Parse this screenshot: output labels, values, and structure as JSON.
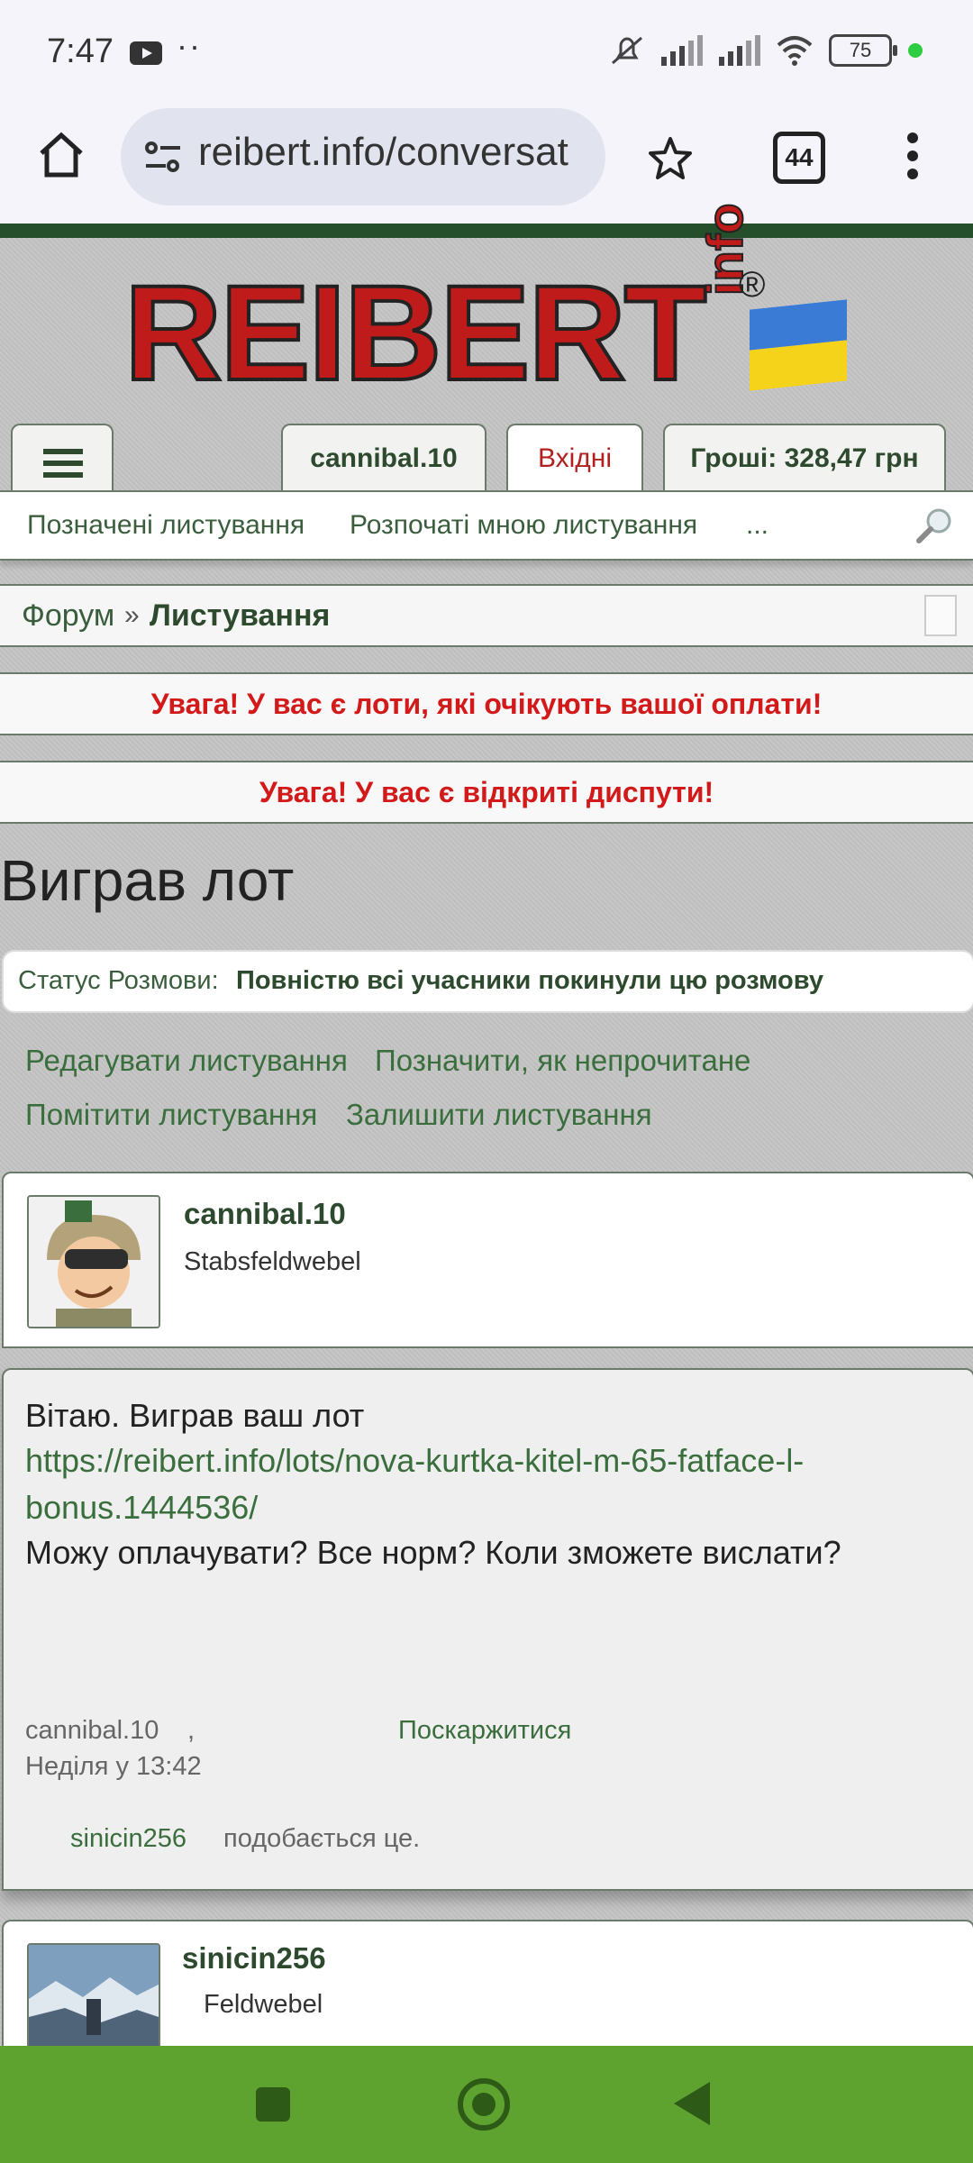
{
  "status_bar": {
    "time": "7:47",
    "dots": "··",
    "battery": "75"
  },
  "browser": {
    "url": "reibert.info/conversat",
    "tab_count": "44"
  },
  "site": {
    "logo_text": "REIBERT",
    "logo_info": "info",
    "logo_reg": "®",
    "tabs": {
      "user": "cannibal.10",
      "inbox": "Вхідні",
      "money": "Гроші: 328,47 грн"
    },
    "subnav": [
      "Позначені листування",
      "Розпочаті мною листування",
      "..."
    ],
    "breadcrumb": {
      "forum": "Форум",
      "sep": "»",
      "current": "Листування"
    },
    "alerts": [
      "Увага! У вас є лоти, які очікують вашої оплати!",
      "Увага! У вас є відкриті диспути!"
    ],
    "page_title": "Виграв лот",
    "status": {
      "label": "Статус Розмови:",
      "value": "Повністю всі учасники покинули цю розмову"
    },
    "actions": [
      "Редагувати листування",
      "Позначити, як непрочитане",
      "Помітити листування",
      "Залишити листування"
    ]
  },
  "posts": {
    "author1": {
      "name": "cannibal.10",
      "rank": "Stabsfeldwebel"
    },
    "message": {
      "line1": "Вітаю. Виграв ваш лот",
      "link1": "https://reibert.info/lots/nova-kurtka-kitel-m-65-fatface-l-",
      "link2": "bonus.1444536/",
      "line2": "Можу оплачувати? Все норм? Коли зможете вислати?",
      "meta_author": "cannibal.10",
      "meta_comma": ",",
      "meta_date": "Неділя у 13:42",
      "report": "Поскаржитися",
      "likes_user": "sinicin256",
      "likes_text": "подобається це."
    },
    "author2": {
      "name": "sinicin256",
      "rank": "Feldwebel"
    }
  }
}
